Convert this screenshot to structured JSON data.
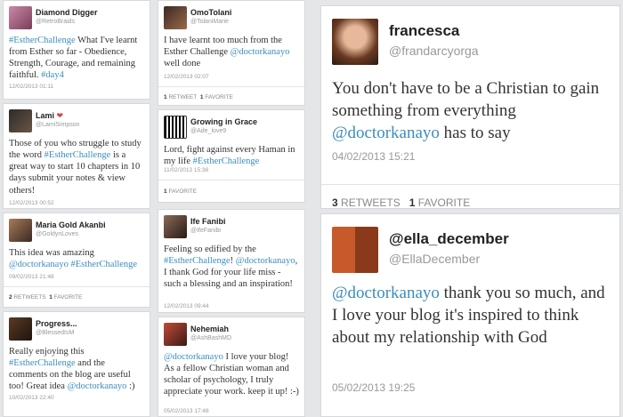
{
  "colors": {
    "page_bg": "#e4e6e8",
    "card_bg": "#ffffff",
    "link": "#3b8dbd",
    "heart": "#d9434f"
  },
  "tweets": [
    {
      "name": "Diamond Digger",
      "handle": "@RetroBraids",
      "text_parts": [
        {
          "t": "#EstherChallenge",
          "hl": true
        },
        {
          "t": " What I've learnt from Esther so far - Obedience, Strength, Courage, and remaining faithful. ",
          "hl": false
        },
        {
          "t": "#day4",
          "hl": true
        }
      ],
      "time": "12/02/2013 01:11"
    },
    {
      "name": "Lami",
      "name_icon": "heart-icon",
      "heart_glyph": "❤",
      "handle": "@LamiSimpson",
      "text_parts": [
        {
          "t": "Those of you who struggle to study the word ",
          "hl": false
        },
        {
          "t": "#EstherChallenge",
          "hl": true
        },
        {
          "t": " is a great way to start 10 chapters in 10 days submit your notes & view others!",
          "hl": false
        }
      ],
      "time": "12/02/2013 00:52"
    },
    {
      "name": "Maria Gold Akanbi",
      "handle": "@GoldynLoves",
      "text_parts": [
        {
          "t": "This idea was amazing ",
          "hl": false
        },
        {
          "t": "@doctorkanayo",
          "hl": true
        },
        {
          "t": " ",
          "hl": false
        },
        {
          "t": "#EstherChallenge",
          "hl": true
        }
      ],
      "time": "09/02/2013 21:48",
      "retweets": "2",
      "retweets_label": "RETWEETS",
      "favorites": "1",
      "favorites_label": "FAVORITE"
    },
    {
      "name": "Progress...",
      "handle": "@BlessedIsM",
      "text_parts": [
        {
          "t": "Really enjoying this ",
          "hl": false
        },
        {
          "t": "#EstherChallenge",
          "hl": true
        },
        {
          "t": " and the comments on the blog are useful too! Great idea ",
          "hl": false
        },
        {
          "t": "@doctorkanayo",
          "hl": true
        },
        {
          "t": " :)",
          "hl": false
        }
      ],
      "time": "10/02/2013 22:40"
    },
    {
      "name": "OmoTolani",
      "handle": "@TolaniMarie",
      "text_parts": [
        {
          "t": "I have learnt too much from the Esther Challenge ",
          "hl": false
        },
        {
          "t": "@doctorkanayo",
          "hl": true
        },
        {
          "t": " well done",
          "hl": false
        }
      ],
      "time": "12/02/2013 02:07",
      "retweets": "1",
      "retweets_label": "RETWEET",
      "favorites": "1",
      "favorites_label": "FAVORITE"
    },
    {
      "name": "Growing in Grace",
      "handle": "@Ade_love9",
      "text_parts": [
        {
          "t": "Lord, fight against every Haman in my life ",
          "hl": false
        },
        {
          "t": "#EstherChallenge",
          "hl": true
        }
      ],
      "time": "11/02/2013 15:38",
      "favorites": "1",
      "favorites_label": "FAVORITE"
    },
    {
      "name": "Ife Fanibi",
      "handle": "@IfeFanibi",
      "text_parts": [
        {
          "t": "Feeling so edified by the ",
          "hl": false
        },
        {
          "t": "#EstherChallenge",
          "hl": true
        },
        {
          "t": "! ",
          "hl": false
        },
        {
          "t": "@doctorkanayo",
          "hl": true
        },
        {
          "t": ", I thank God for your life miss - such a blessing and an inspiration!",
          "hl": false
        }
      ],
      "time": "12/02/2013 09:44"
    },
    {
      "name": "Nehemiah",
      "handle": "@AshBashMD",
      "text_parts": [
        {
          "t": "@doctorkanayo",
          "hl": true
        },
        {
          "t": " I love your blog! As a fellow Christian woman and scholar of psychology, I truly appreciate your work. keep it up! :-)",
          "hl": false
        }
      ],
      "time": "05/02/2013 17:48"
    },
    {
      "name": "francesca",
      "handle": "@frandarcyorga",
      "text_parts": [
        {
          "t": "You don't have to be a Christian to gain something from everything ",
          "hl": false
        },
        {
          "t": "@doctorkanayo",
          "hl": true
        },
        {
          "t": " has to say",
          "hl": false
        }
      ],
      "time": "04/02/2013 15:21",
      "retweets": "3",
      "retweets_label": "RETWEETS",
      "favorites": "1",
      "favorites_label": "FAVORITE"
    },
    {
      "name": "@ella_december",
      "handle": "@EllaDecember",
      "text_parts": [
        {
          "t": "@doctorkanayo",
          "hl": true
        },
        {
          "t": " thank you so much, and I love your blog it's inspired to think about my relationship with God",
          "hl": false
        }
      ],
      "time": "05/02/2013 19:25"
    }
  ]
}
